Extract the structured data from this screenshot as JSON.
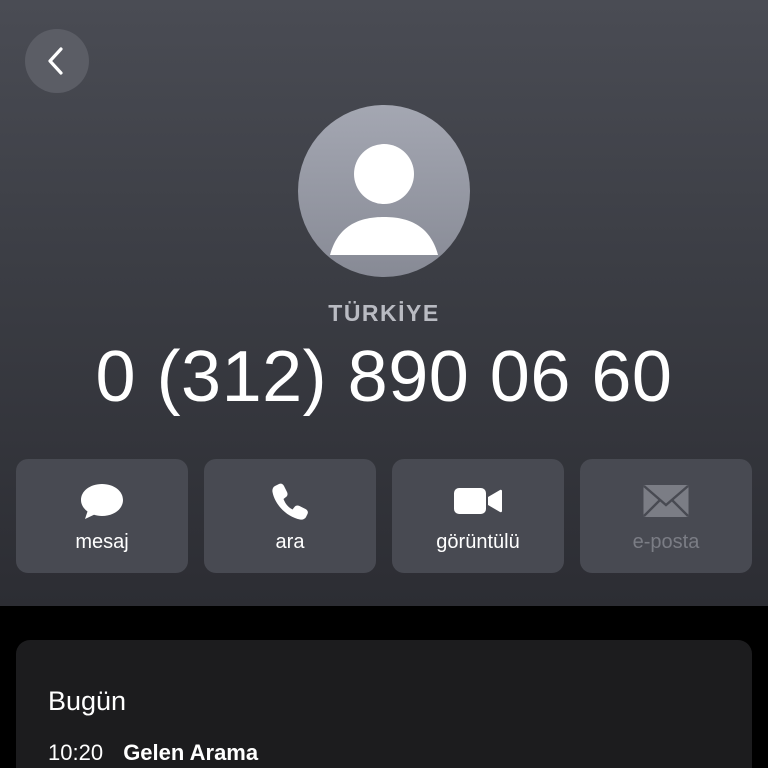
{
  "contact": {
    "country": "TÜRKİYE",
    "phone_number": "0 (312) 890 06 60"
  },
  "actions": [
    {
      "label": "mesaj",
      "icon": "message-bubble-icon",
      "enabled": true
    },
    {
      "label": "ara",
      "icon": "phone-icon",
      "enabled": true
    },
    {
      "label": "görüntülü",
      "icon": "video-camera-icon",
      "enabled": true
    },
    {
      "label": "e-posta",
      "icon": "envelope-icon",
      "enabled": false
    }
  ],
  "recent_calls": {
    "day_label": "Bugün",
    "items": [
      {
        "time": "10:20",
        "type": "Gelen Arama"
      }
    ]
  },
  "colors": {
    "header_top": "#4a4c54",
    "header_bottom": "#2c2d33",
    "button_bg": "#484a52",
    "card_bg": "#1c1c1e",
    "disabled_text": "#7b7d85"
  }
}
